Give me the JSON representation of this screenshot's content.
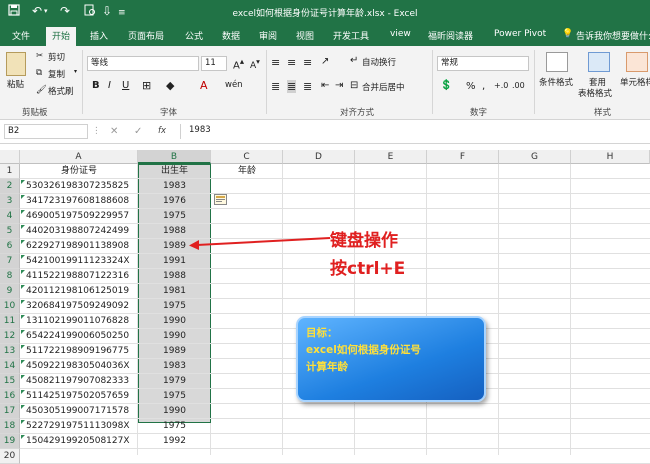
{
  "window": {
    "title": "excel如何根据身份证号计算年龄.xlsx  -  Excel",
    "quick_access": [
      "save-icon",
      "undo-icon",
      "redo-icon",
      "print-preview-icon",
      "customize-icon"
    ]
  },
  "tabs": [
    "文件",
    "开始",
    "插入",
    "页面布局",
    "公式",
    "数据",
    "审阅",
    "视图",
    "开发工具",
    "view",
    "福昕阅读器",
    "Power Pivot"
  ],
  "tell_me": "告诉我你想要做什么",
  "ribbon": {
    "paste": "粘贴",
    "cut": "剪切",
    "copy": "复制",
    "format_painter": "格式刷",
    "font_name": "等线",
    "font_size": "11",
    "bold": "B",
    "italic": "I",
    "underline": "U",
    "wrap_text": "自动换行",
    "merge_center": "合并后居中",
    "number_format": "常规",
    "percent": "%",
    "comma": ",",
    "conditional_format": "条件格式",
    "format_as_table_1": "套用",
    "format_as_table_2": "表格格式",
    "cell_styles": "单元格样",
    "group_labels": {
      "clipboard": "剪贴板",
      "font": "字体",
      "alignment": "对齐方式",
      "number": "数字",
      "styles": "样式"
    }
  },
  "formula_bar": {
    "name_box": "B2",
    "fx": "fx",
    "value": "1983"
  },
  "columns": [
    "A",
    "B",
    "C",
    "D",
    "E",
    "F",
    "G",
    "H"
  ],
  "rows": [
    {
      "num": "1",
      "a": "身份证号",
      "b": "出生年",
      "c": "年龄"
    },
    {
      "num": "2",
      "a": "530326198307235825",
      "b": "1983",
      "c": ""
    },
    {
      "num": "3",
      "a": "341723197608188608",
      "b": "1976",
      "c": ""
    },
    {
      "num": "4",
      "a": "469005197509229957",
      "b": "1975",
      "c": ""
    },
    {
      "num": "5",
      "a": "440203198807242499",
      "b": "1988",
      "c": ""
    },
    {
      "num": "6",
      "a": "622927198901138908",
      "b": "1989",
      "c": ""
    },
    {
      "num": "7",
      "a": "54210019911123324X",
      "b": "1991",
      "c": ""
    },
    {
      "num": "8",
      "a": "411522198807122316",
      "b": "1988",
      "c": ""
    },
    {
      "num": "9",
      "a": "420112198106125019",
      "b": "1981",
      "c": ""
    },
    {
      "num": "10",
      "a": "320684197509249092",
      "b": "1975",
      "c": ""
    },
    {
      "num": "11",
      "a": "131102199011076828",
      "b": "1990",
      "c": ""
    },
    {
      "num": "12",
      "a": "654224199006050250",
      "b": "1990",
      "c": ""
    },
    {
      "num": "13",
      "a": "511722198909196775",
      "b": "1989",
      "c": ""
    },
    {
      "num": "14",
      "a": "45092219830504036X",
      "b": "1983",
      "c": ""
    },
    {
      "num": "15",
      "a": "450821197907082333",
      "b": "1979",
      "c": ""
    },
    {
      "num": "16",
      "a": "511425197502057659",
      "b": "1975",
      "c": ""
    },
    {
      "num": "17",
      "a": "450305199007171578",
      "b": "1990",
      "c": ""
    },
    {
      "num": "18",
      "a": "52272919751113098X",
      "b": "1975",
      "c": ""
    },
    {
      "num": "19",
      "a": "15042919920508127X",
      "b": "1992",
      "c": ""
    },
    {
      "num": "20",
      "a": "",
      "b": "",
      "c": ""
    }
  ],
  "annotation": {
    "line1": "键盘操作",
    "line2": "按ctrl+E"
  },
  "goal_box": {
    "title": "目标：",
    "line1": "excel如何根据身份证号",
    "line2": "计算年龄"
  },
  "colors": {
    "excel_green": "#217346",
    "annotation_red": "#e02020",
    "goal_text": "#ffe03a"
  }
}
